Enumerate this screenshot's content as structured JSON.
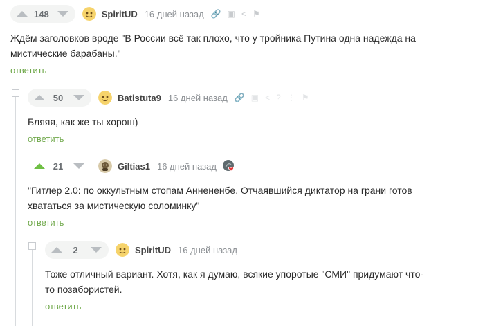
{
  "comments": [
    {
      "rating": "148",
      "username": "SpiritUD",
      "time": "16 дней назад",
      "text": "Ждём заголовков вроде \"В России всё так плохо, что у тройника Путина одна надежда на мистические барабаны.\"",
      "reply_label": "ответить"
    },
    {
      "rating": "50",
      "username": "Batistuta9",
      "time": "16 дней назад",
      "text": "Бляяя, как же ты хорош)",
      "reply_label": "ответить"
    },
    {
      "rating": "21",
      "username": "Giltias1",
      "time": "16 дней назад",
      "text": "\"Гитлер 2.0: по оккультным стопам Аннененбе. Отчаявшийся диктатор на грани готов хвататься за мистическую соломинку\"",
      "reply_label": "ответить"
    },
    {
      "rating": "2",
      "username": "SpiritUD",
      "time": "16 дней назад",
      "text": "Тоже отличный вариант. Хотя, как я думаю, всякие упоротые \"СМИ\" придумают что-то позабористей.",
      "reply_label": "ответить"
    }
  ],
  "colors": {
    "accent_green": "#6fa84a",
    "upvote_active": "#6fbf44",
    "muted": "#8b8f93"
  }
}
